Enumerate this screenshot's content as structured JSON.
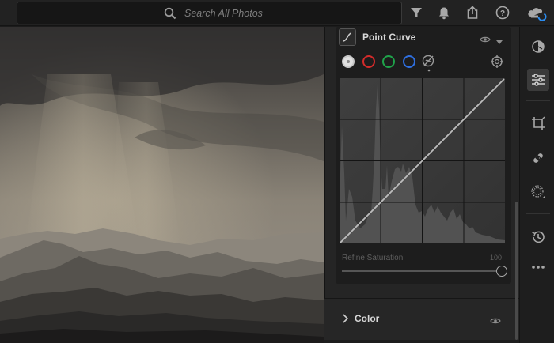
{
  "search": {
    "placeholder": "Search All Photos"
  },
  "toolbar": {
    "icons": [
      "filter-icon",
      "bell-icon",
      "share-icon",
      "help-icon",
      "cloud-sync-icon"
    ]
  },
  "point_curve": {
    "title": "Point Curve",
    "channels": [
      "luminance",
      "red",
      "green",
      "blue",
      "parametric"
    ],
    "selected_channel": "luminance",
    "refine_saturation_label": "Refine Saturation",
    "refine_saturation_value": "100"
  },
  "color_section": {
    "label": "Color"
  },
  "colors": {
    "red": "#d42b2b",
    "green": "#1fa34a",
    "blue": "#2f6fe0",
    "accent_cloud": "#2a8cf0"
  },
  "tools": [
    "presets-icon",
    "edit-sliders-icon",
    "crop-icon",
    "healing-icon",
    "masking-icon",
    "history-icon",
    "more-icon"
  ]
}
